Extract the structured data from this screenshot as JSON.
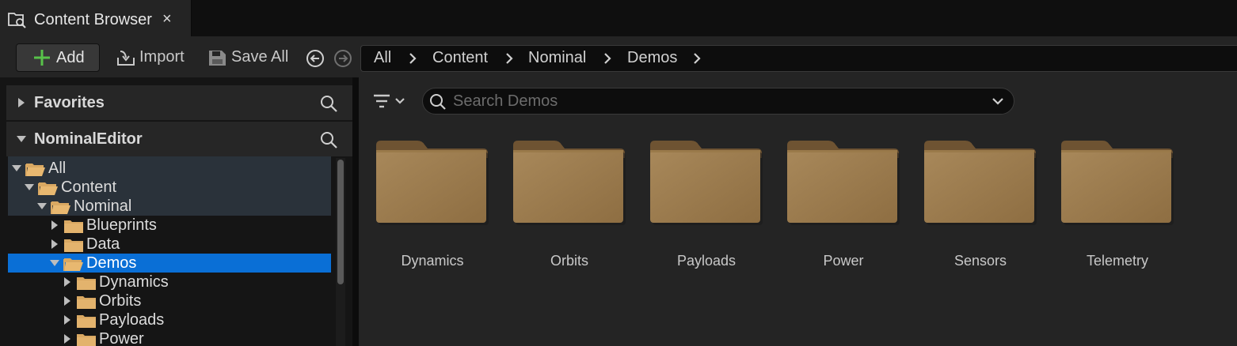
{
  "tab": {
    "title": "Content Browser",
    "close": "×",
    "icon": "content-browser-icon"
  },
  "toolbar": {
    "add_label": "Add",
    "import_label": "Import",
    "save_all_label": "Save All"
  },
  "breadcrumb": [
    "All",
    "Content",
    "Nominal",
    "Demos"
  ],
  "sidebar": {
    "favorites_label": "Favorites",
    "editor_label": "NominalEditor",
    "tree": [
      {
        "label": "All",
        "depth": 0,
        "expanded": true
      },
      {
        "label": "Content",
        "depth": 1,
        "expanded": true
      },
      {
        "label": "Nominal",
        "depth": 2,
        "expanded": true
      },
      {
        "label": "Blueprints",
        "depth": 3,
        "expanded": false
      },
      {
        "label": "Data",
        "depth": 3,
        "expanded": false
      },
      {
        "label": "Demos",
        "depth": 3,
        "expanded": true,
        "selected": true
      },
      {
        "label": "Dynamics",
        "depth": 4,
        "expanded": false
      },
      {
        "label": "Orbits",
        "depth": 4,
        "expanded": false
      },
      {
        "label": "Payloads",
        "depth": 4,
        "expanded": false
      },
      {
        "label": "Power",
        "depth": 4,
        "expanded": false
      }
    ]
  },
  "search": {
    "placeholder": "Search Demos"
  },
  "folders": [
    "Dynamics",
    "Orbits",
    "Payloads",
    "Power",
    "Sensors",
    "Telemetry"
  ],
  "colors": {
    "folder": "#9a7a4a",
    "selection": "#0a6fd6",
    "accent_green": "#58c24a"
  }
}
